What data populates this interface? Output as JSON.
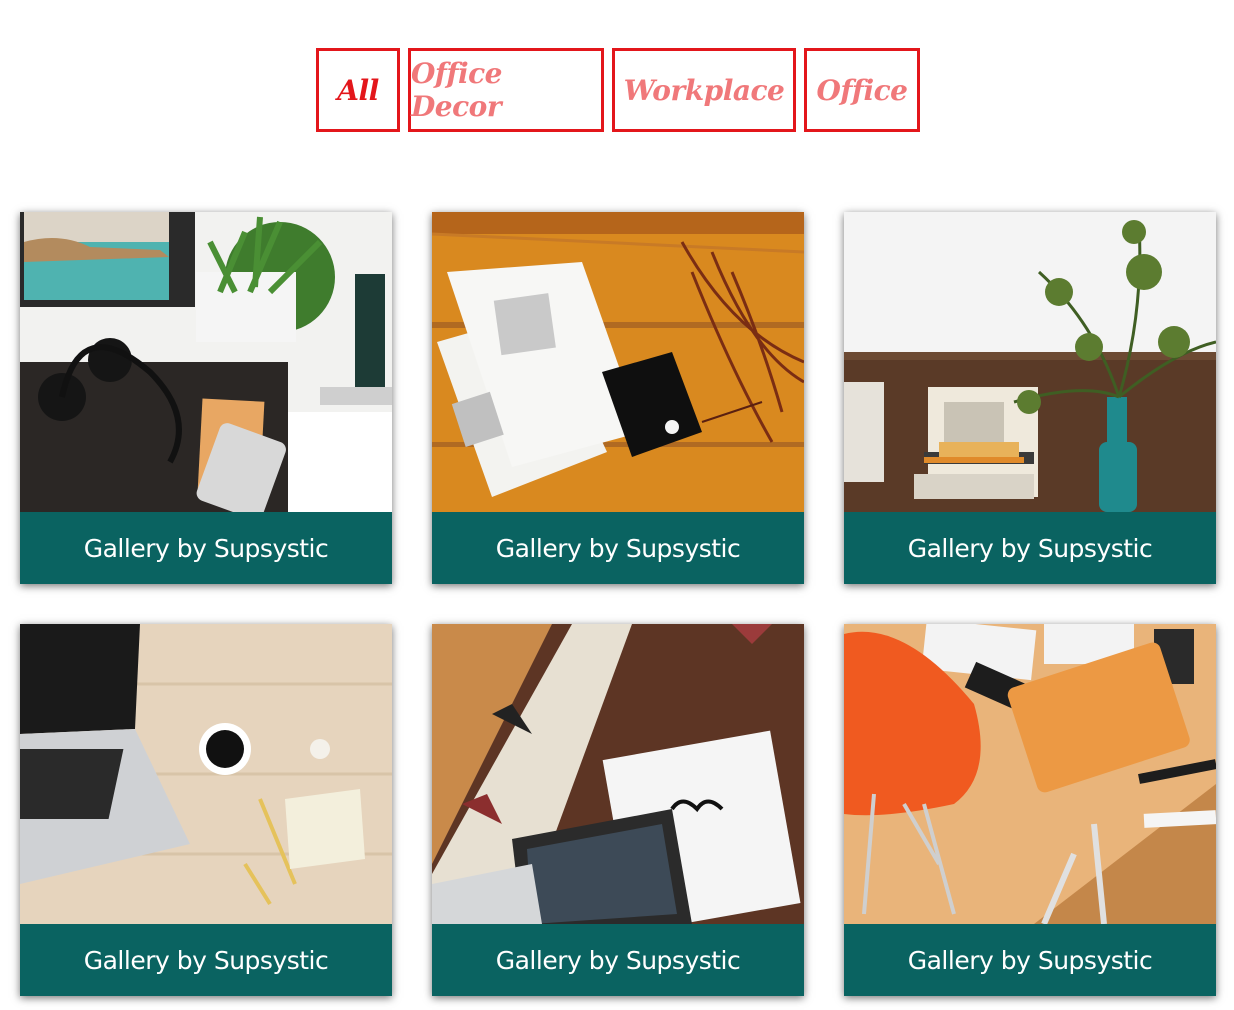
{
  "filters": {
    "items": [
      {
        "label": "All",
        "active": true
      },
      {
        "label": "Office Decor",
        "active": false
      },
      {
        "label": "Workplace",
        "active": false
      },
      {
        "label": "Office",
        "active": false
      }
    ]
  },
  "gallery": {
    "items": [
      {
        "caption": "Gallery by Supsystic",
        "icon": "desk-headphones-phone-photo"
      },
      {
        "caption": "Gallery by Supsystic",
        "icon": "open-magazine-wood-table-photo"
      },
      {
        "caption": "Gallery by Supsystic",
        "icon": "desk-books-plant-vase-photo"
      },
      {
        "caption": "Gallery by Supsystic",
        "icon": "laptop-coffee-pencils-photo"
      },
      {
        "caption": "Gallery by Supsystic",
        "icon": "laptop-notebook-glasses-rug-photo"
      },
      {
        "caption": "Gallery by Supsystic",
        "icon": "orange-chair-notebook-desk-photo"
      }
    ]
  },
  "colors": {
    "filter_border": "#e3161b",
    "filter_active_text": "#e3161b",
    "filter_inactive_text": "#f0787a",
    "caption_background": "#0a6361",
    "caption_text": "#ffffff"
  }
}
